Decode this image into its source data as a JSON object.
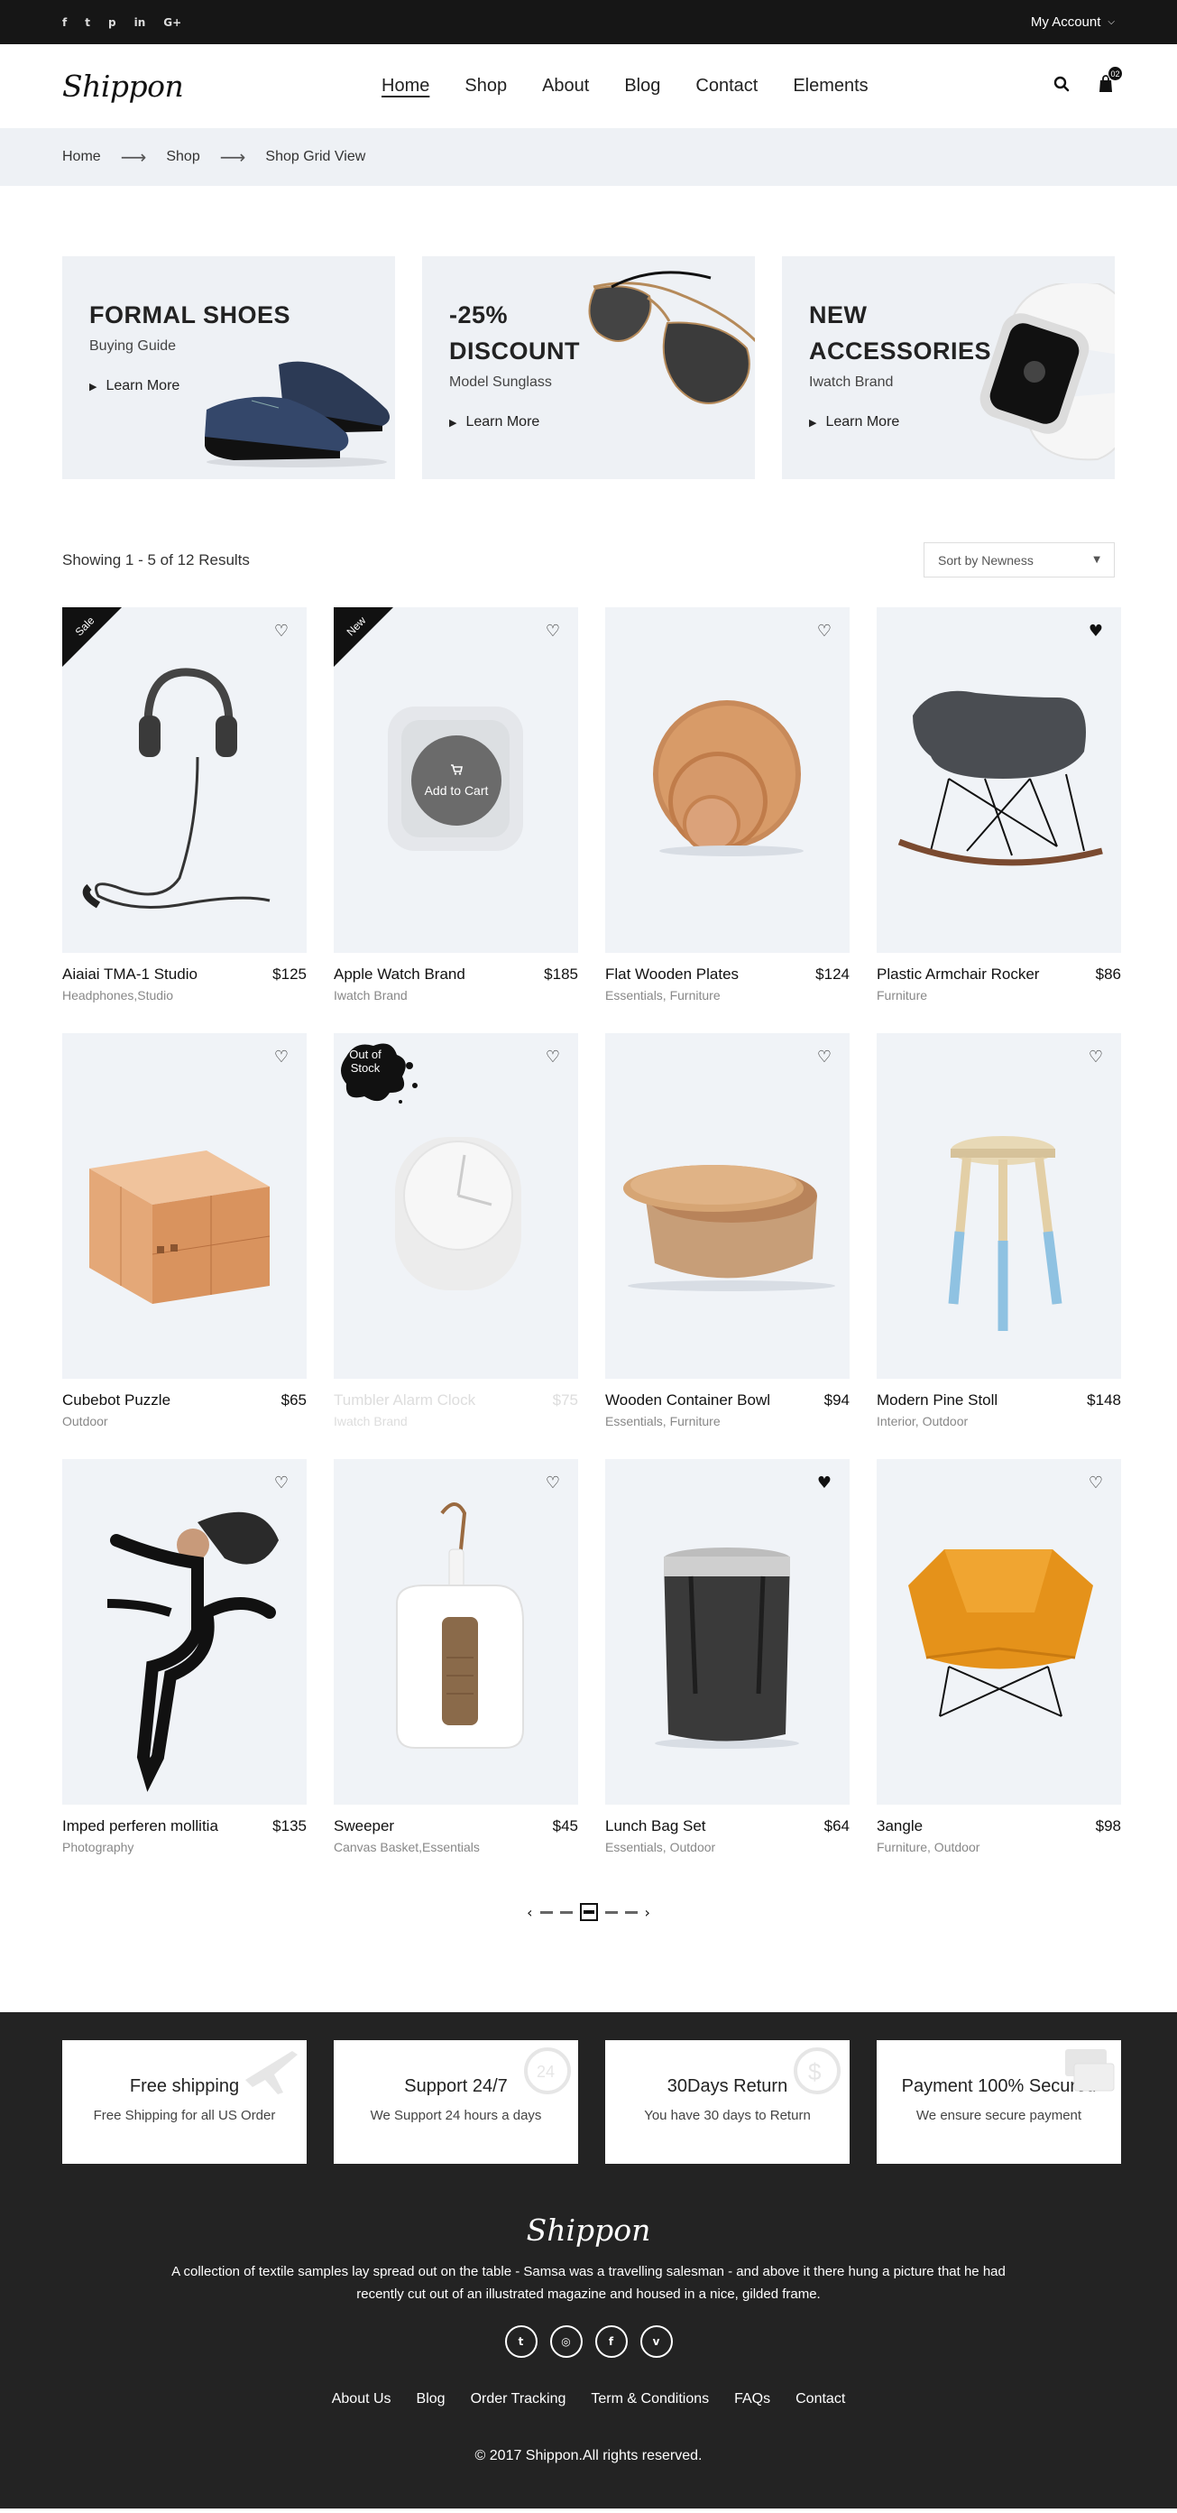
{
  "topbar": {
    "social": [
      {
        "icon": "facebook-icon",
        "glyph": "f"
      },
      {
        "icon": "twitter-icon",
        "glyph": "t"
      },
      {
        "icon": "pinterest-icon",
        "glyph": "p"
      },
      {
        "icon": "linkedin-icon",
        "glyph": "in"
      },
      {
        "icon": "google-plus-icon",
        "glyph": "G+"
      }
    ],
    "account_label": "My Account"
  },
  "header": {
    "logo": "Shippon",
    "nav": [
      "Home",
      "Shop",
      "About",
      "Blog",
      "Contact",
      "Elements"
    ],
    "active_nav": "Home",
    "cart_count": "02"
  },
  "breadcrumb": [
    "Home",
    "Shop",
    "Shop Grid View"
  ],
  "banners": [
    {
      "title_lines": [
        "FORMAL SHOES"
      ],
      "subtitle": "Buying Guide",
      "link": "Learn More"
    },
    {
      "title_lines": [
        "-25%",
        "DISCOUNT"
      ],
      "subtitle": "Model Sunglass",
      "link": "Learn More"
    },
    {
      "title_lines": [
        "NEW",
        "ACCESSORIES"
      ],
      "subtitle": "Iwatch Brand",
      "link": "Learn More"
    }
  ],
  "toolbar": {
    "showing": "Showing 1 - 5 of 12  Results",
    "sort": "Sort by Newness"
  },
  "products": [
    {
      "name": "Aiaiai TMA-1 Studio",
      "price": "$125",
      "category": "Headphones,Studio",
      "badge": "Sale",
      "wishlisted": false,
      "image": "headphones"
    },
    {
      "name": "Apple Watch Brand",
      "price": "$185",
      "category": "Iwatch Brand",
      "badge": "New",
      "wishlisted": false,
      "image": "watch",
      "add_to_cart": "Add to Cart"
    },
    {
      "name": "Flat Wooden Plates",
      "price": "$124",
      "category": "Essentials, Furniture",
      "badge": "",
      "wishlisted": false,
      "image": "plates"
    },
    {
      "name": "Plastic Armchair Rocker",
      "price": "$86",
      "category": "Furniture",
      "badge": "",
      "wishlisted": true,
      "image": "rocker"
    },
    {
      "name": "Cubebot Puzzle",
      "price": "$65",
      "category": "Outdoor",
      "badge": "",
      "wishlisted": false,
      "image": "cube"
    },
    {
      "name": "Tumbler Alarm Clock",
      "price": "$75",
      "category": "Iwatch Brand",
      "badge": "Out of Stock",
      "wishlisted": false,
      "image": "clock",
      "faded": true
    },
    {
      "name": "Wooden Container Bowl",
      "price": "$94",
      "category": "Essentials, Furniture",
      "badge": "",
      "wishlisted": false,
      "image": "bowl"
    },
    {
      "name": "Modern Pine Stoll",
      "price": "$148",
      "category": "Interior, Outdoor",
      "badge": "",
      "wishlisted": false,
      "image": "stool"
    },
    {
      "name": "Imped perferen mollitia",
      "price": "$135",
      "category": "Photography",
      "badge": "",
      "wishlisted": false,
      "image": "dancer"
    },
    {
      "name": "Sweeper",
      "price": "$45",
      "category": "Canvas Basket,Essentials",
      "badge": "",
      "wishlisted": false,
      "image": "sweeper"
    },
    {
      "name": "Lunch Bag Set",
      "price": "$64",
      "category": "Essentials, Outdoor",
      "badge": "",
      "wishlisted": true,
      "image": "bag"
    },
    {
      "name": "3angle",
      "price": "$98",
      "category": "Furniture, Outdoor",
      "badge": "",
      "wishlisted": false,
      "image": "chair"
    }
  ],
  "features": [
    {
      "title": "Free shipping",
      "desc": "Free Shipping for all US Order",
      "icon": "airplane-icon"
    },
    {
      "title": "Support 24/7",
      "desc": "We Support 24 hours a days",
      "icon": "clock-24-icon"
    },
    {
      "title": "30Days Return",
      "desc": "You have 30 days to Return",
      "icon": "dollar-return-icon"
    },
    {
      "title": "Payment 100% Secured",
      "desc": "We ensure secure payment",
      "icon": "credit-card-icon"
    }
  ],
  "footer": {
    "logo": "Shippon",
    "description": "A collection of textile samples lay spread out on the table - Samsa was a travelling salesman - and above it there hung a picture that he had recently cut out of an illustrated magazine and housed in a nice, gilded frame.",
    "social": [
      {
        "icon": "twitter-icon",
        "glyph": "t"
      },
      {
        "icon": "dribbble-icon",
        "glyph": "◎"
      },
      {
        "icon": "facebook-icon",
        "glyph": "f"
      },
      {
        "icon": "vimeo-icon",
        "glyph": "v"
      }
    ],
    "links": [
      "About Us",
      "Blog",
      "Order Tracking",
      "Term & Conditions",
      "FAQs",
      "Contact"
    ],
    "copyright": "© 2017 Shippon.All rights reserved."
  }
}
